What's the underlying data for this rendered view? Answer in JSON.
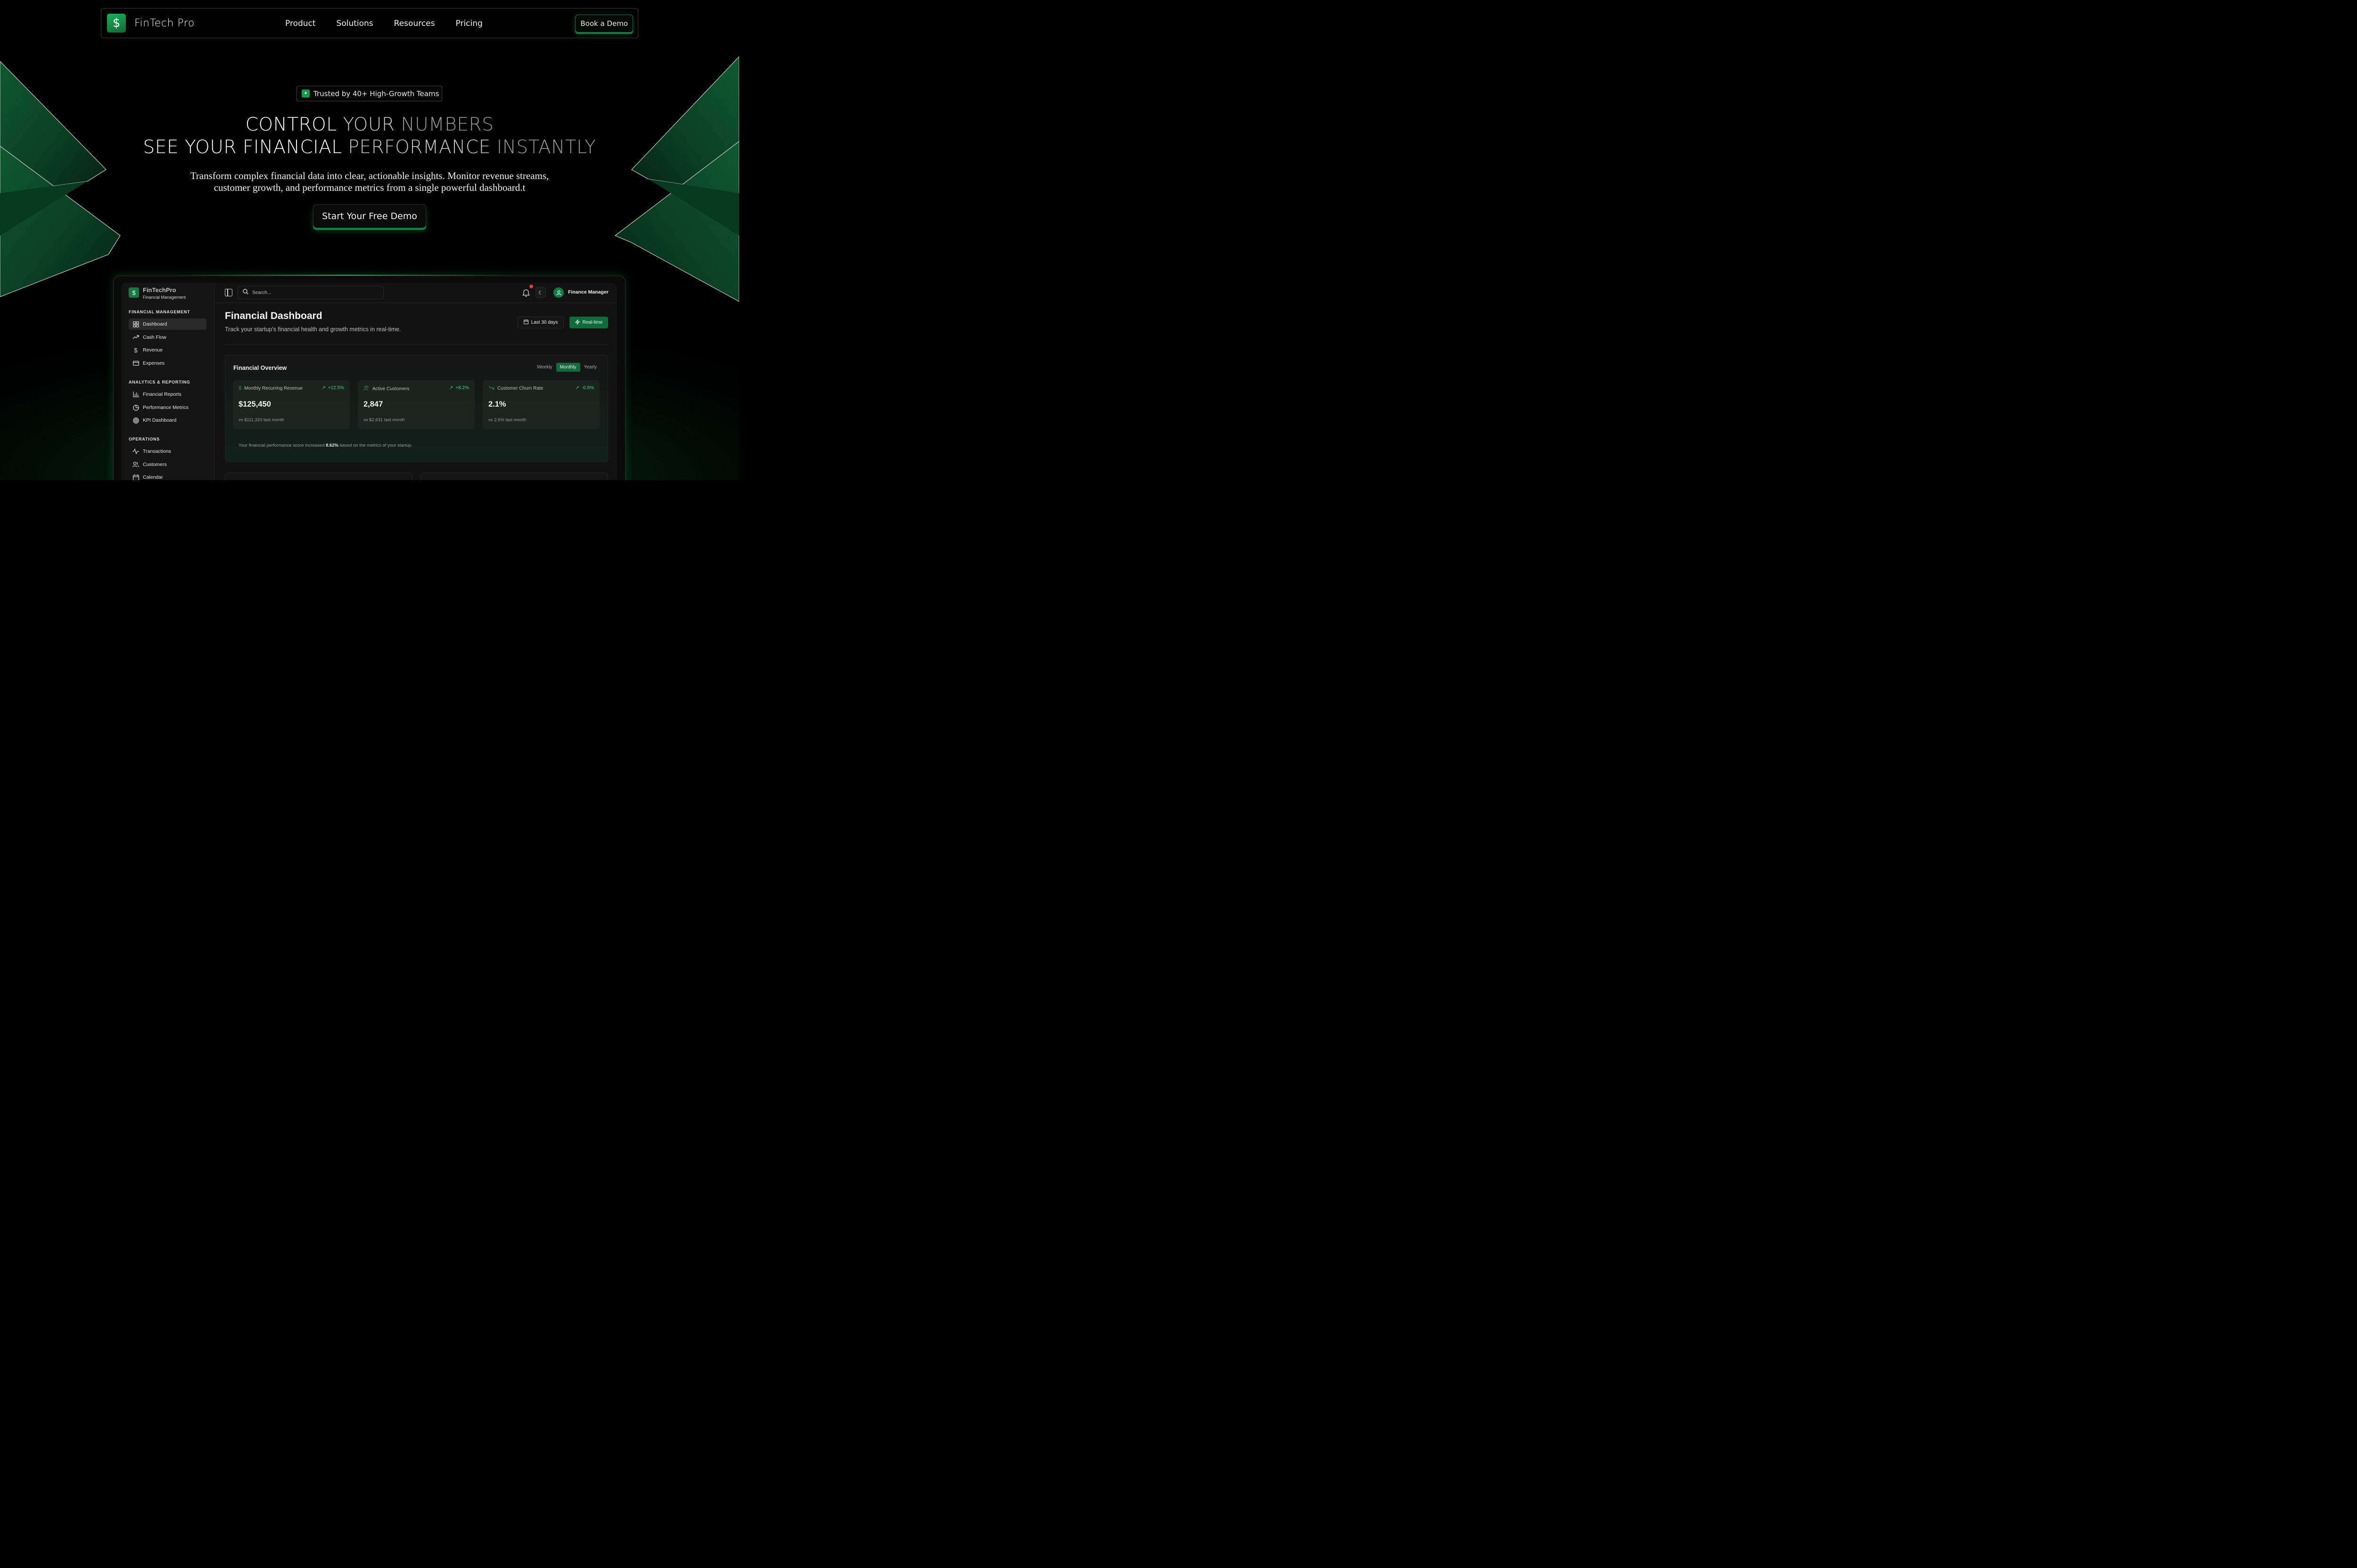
{
  "nav": {
    "brand": "FinTech Pro",
    "logo_symbol": "$",
    "links": [
      "Product",
      "Solutions",
      "Resources",
      "Pricing"
    ],
    "cta": "Book a Demo"
  },
  "hero": {
    "badge": "Trusted by 40+ High-Growth Teams",
    "headline_1": [
      "CONTROL",
      "YOUR",
      "NUMBERS"
    ],
    "headline_2": [
      "SEE",
      "YOUR",
      "FINANCIAL",
      "PERFORMANCE",
      "INSTANTLY"
    ],
    "subtitle_1": "Transform complex financial data into clear, actionable insights. Monitor revenue streams,",
    "subtitle_2": "customer growth, and performance metrics from a single powerful dashboard.t",
    "cta": "Start Your Free Demo"
  },
  "app": {
    "brand": "FinTechPro",
    "brand_sub": "Financial Management",
    "sections": [
      {
        "title": "FINANCIAL MANAGEMENT",
        "items": [
          "Dashboard",
          "Cash Flow",
          "Revenue",
          "Expenses"
        ]
      },
      {
        "title": "ANALYTICS & REPORTING",
        "items": [
          "Financial Reports",
          "Performance Metrics",
          "KPI Dashboard"
        ]
      },
      {
        "title": "OPERATIONS",
        "items": [
          "Transactions",
          "Customers",
          "Calendar"
        ]
      }
    ],
    "search_placeholder": "Search...",
    "user": "Finance Manager",
    "title": "Financial Dashboard",
    "description": "Track your startup's financial health and growth metrics in real-time.",
    "range_button": "Last 30 days",
    "realtime_button": "Real-time",
    "overview": {
      "title": "Financial Overview",
      "periods": [
        "Weekly",
        "Monthly",
        "Yearly"
      ],
      "active_period": "Monthly",
      "metrics": [
        {
          "label": "Monthly Recurring Revenue",
          "change": "+12.5%",
          "value": "$125,450",
          "note": "vs $111,320 last month"
        },
        {
          "label": "Active Customers",
          "change": "+8.2%",
          "value": "2,847",
          "note": "vs $2,631 last month"
        },
        {
          "label": "Customer Churn Rate",
          "change": "-0.5%",
          "value": "2.1%",
          "note": "vs 2.6% last month"
        }
      ],
      "score_pre": "Your financial performance score increased ",
      "score_value": "8.62%",
      "score_post": " based on the metrics of your startup."
    }
  },
  "colors": {
    "accent": "#1fae5b",
    "accent_dark": "#0f6b3b",
    "positive": "#2fd17a",
    "alert": "#e53935"
  }
}
